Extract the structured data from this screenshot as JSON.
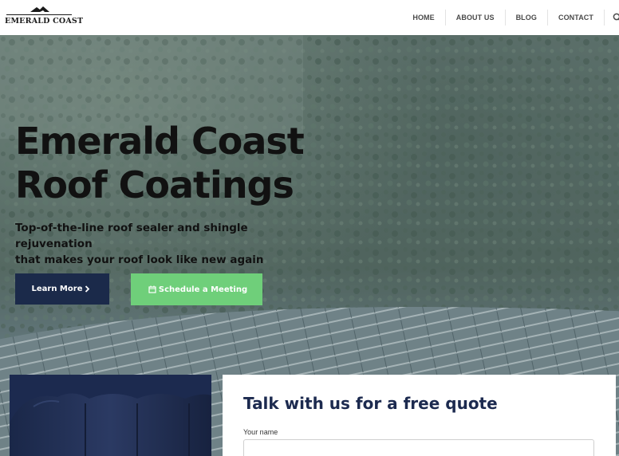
{
  "header": {
    "logo_text": "EMERALD COAST",
    "nav": [
      {
        "label": "HOME"
      },
      {
        "label": "ABOUT US"
      },
      {
        "label": "BLOG"
      },
      {
        "label": "CONTACT"
      }
    ],
    "search_icon": "search-icon"
  },
  "hero": {
    "title_line1": "Emerald Coast",
    "title_line2": "Roof Coatings",
    "subtitle_line1": "Top-of-the-line roof sealer and shingle rejuvenation",
    "subtitle_line2": "that makes your roof look like new again",
    "learn_more_label": "Learn More",
    "learn_more_icon": "chevron-right-icon",
    "schedule_label": "Schedule a Meeting",
    "schedule_icon": "calendar-icon"
  },
  "quote": {
    "title": "Talk with us for a free quote",
    "name_label": "Your name",
    "name_value": ""
  },
  "colors": {
    "navy": "#1b2a4a",
    "green_button": "#6fcf7a",
    "title_text": "#111111"
  }
}
